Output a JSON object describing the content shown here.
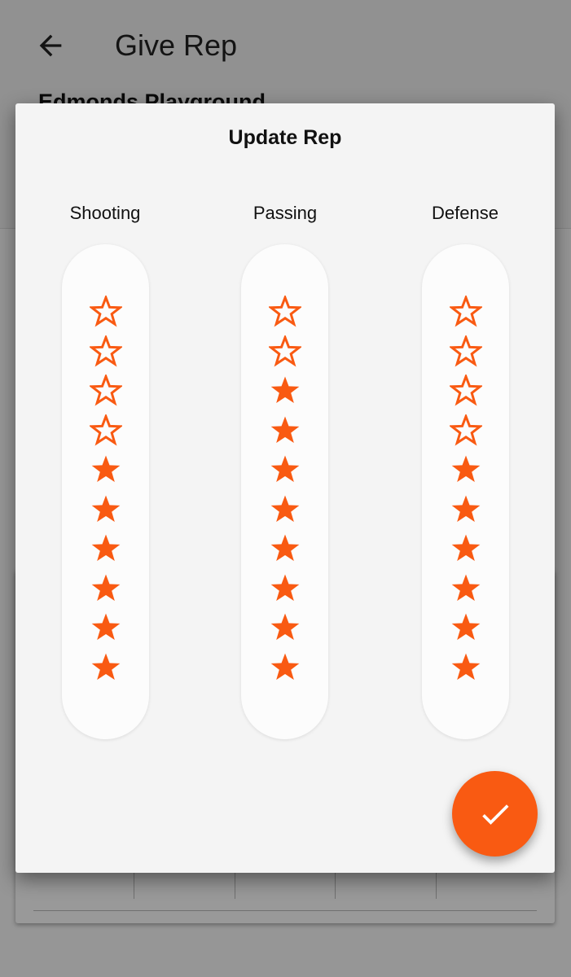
{
  "app_bar": {
    "title": "Give Rep",
    "subtitle": "Edmonds Playground"
  },
  "icons": {
    "back": "arrow-back-icon",
    "submit": "check-icon",
    "star_filled": "star-filled-icon",
    "star_outline": "star-outline-icon"
  },
  "colors": {
    "accent": "#f95a12",
    "dialog_background": "#f4f4f4",
    "pill_background": "#fcfcfc"
  },
  "dialog": {
    "title": "Update Rep",
    "max_rating": 10,
    "categories": [
      {
        "label": "Shooting",
        "rating": 6
      },
      {
        "label": "Passing",
        "rating": 8
      },
      {
        "label": "Defense",
        "rating": 6
      }
    ]
  }
}
